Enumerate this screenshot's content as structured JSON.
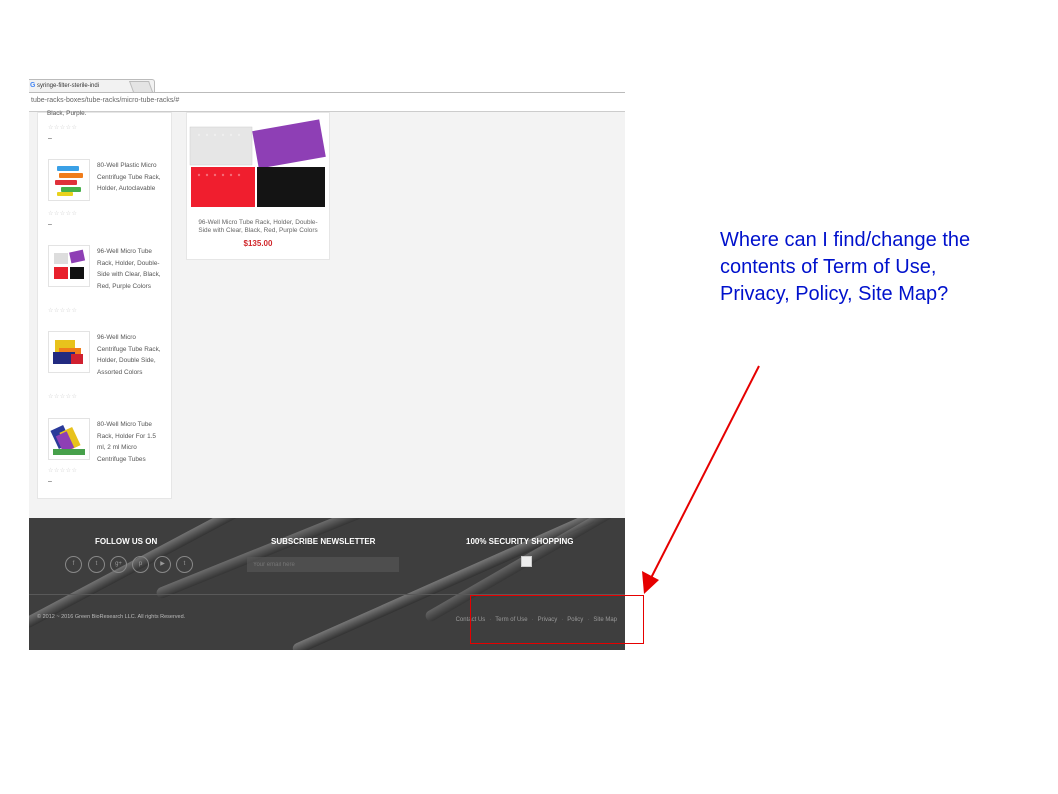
{
  "browser": {
    "tab_title": "syringe-filter-sterile-indi",
    "url_fragment": "tube-racks-boxes/tube-racks/micro-tube-racks/#"
  },
  "sidebar": {
    "top_fragment": "Black, Purple.",
    "stars": "☆☆☆☆☆",
    "dash": "–",
    "items": [
      {
        "name": "80-Well Plastic Micro Centrifuge Tube Rack, Holder, Autoclavable"
      },
      {
        "name": "96-Well Micro Tube Rack, Holder, Double-Side with Clear, Black, Red, Purple Colors"
      },
      {
        "name": "96-Well Micro Centrifuge Tube Rack, Holder, Double Side, Assorted Colors"
      },
      {
        "name": "80-Well Micro Tube Rack, Holder For 1.5 ml, 2 ml Micro Centrifuge Tubes"
      }
    ]
  },
  "product_card": {
    "name": "96-Well Micro Tube Rack, Holder, Double-Side with Clear, Black, Red, Purple Colors",
    "price": "$135.00"
  },
  "footer": {
    "follow_title": "FOLLOW US ON",
    "social_icons": [
      "f",
      "t",
      "g+",
      "p",
      "▶",
      "t"
    ],
    "newsletter_title": "SUBSCRIBE NEWSLETTER",
    "email_placeholder": "Your email here",
    "security_title": "100% SECURITY SHOPPING",
    "copyright": "© 2012 ~ 2016 Green BioResearch LLC. All rights Reserved.",
    "links": [
      "Contact Us",
      "Term of Use",
      "Privacy",
      "Policy",
      "Site Map"
    ]
  },
  "annotation": {
    "question": "Where can I find/change the contents of Term of Use, Privacy, Policy, Site Map?",
    "color": "#0011cc",
    "arrow_color": "#e60000"
  }
}
